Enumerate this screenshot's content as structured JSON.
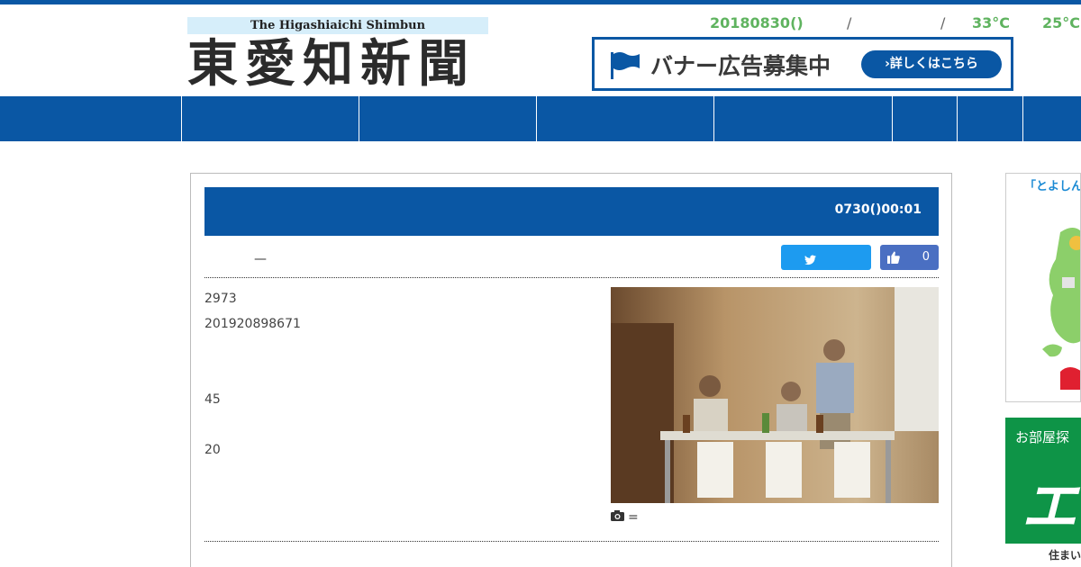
{
  "header": {
    "logo_subtitle": "The Higashiaichi Shimbun",
    "logo_title": "東愛知新聞",
    "date": "20180830()",
    "separator": "/",
    "temp_high": "33°C",
    "temp_low": "25°C"
  },
  "banner": {
    "text": "バナー広告募集中",
    "button_label": "›詳しくはこちら",
    "icon": "flag-icon"
  },
  "nav": {
    "items": [
      "",
      "",
      "",
      "",
      "",
      "",
      ""
    ]
  },
  "article": {
    "timestamp": "0730()00:01",
    "byline": "—",
    "share": {
      "twitter_icon": "twitter-icon",
      "like_icon": "thumbs-up-icon",
      "like_count": "0"
    },
    "paragraphs": [
      "2973",
      "201920898671",
      "45",
      "20"
    ],
    "caption": "="
  },
  "sidebar": {
    "ad1_title": "「とよしん」",
    "ad2_title": "お部屋探",
    "ad2_logo": "エ",
    "ad2_footer": "住まい"
  },
  "colors": {
    "brand_blue": "#0a57a4",
    "accent_green": "#5fb35f",
    "twitter_blue": "#1d9bf0",
    "like_blue": "#4a6fc2"
  }
}
